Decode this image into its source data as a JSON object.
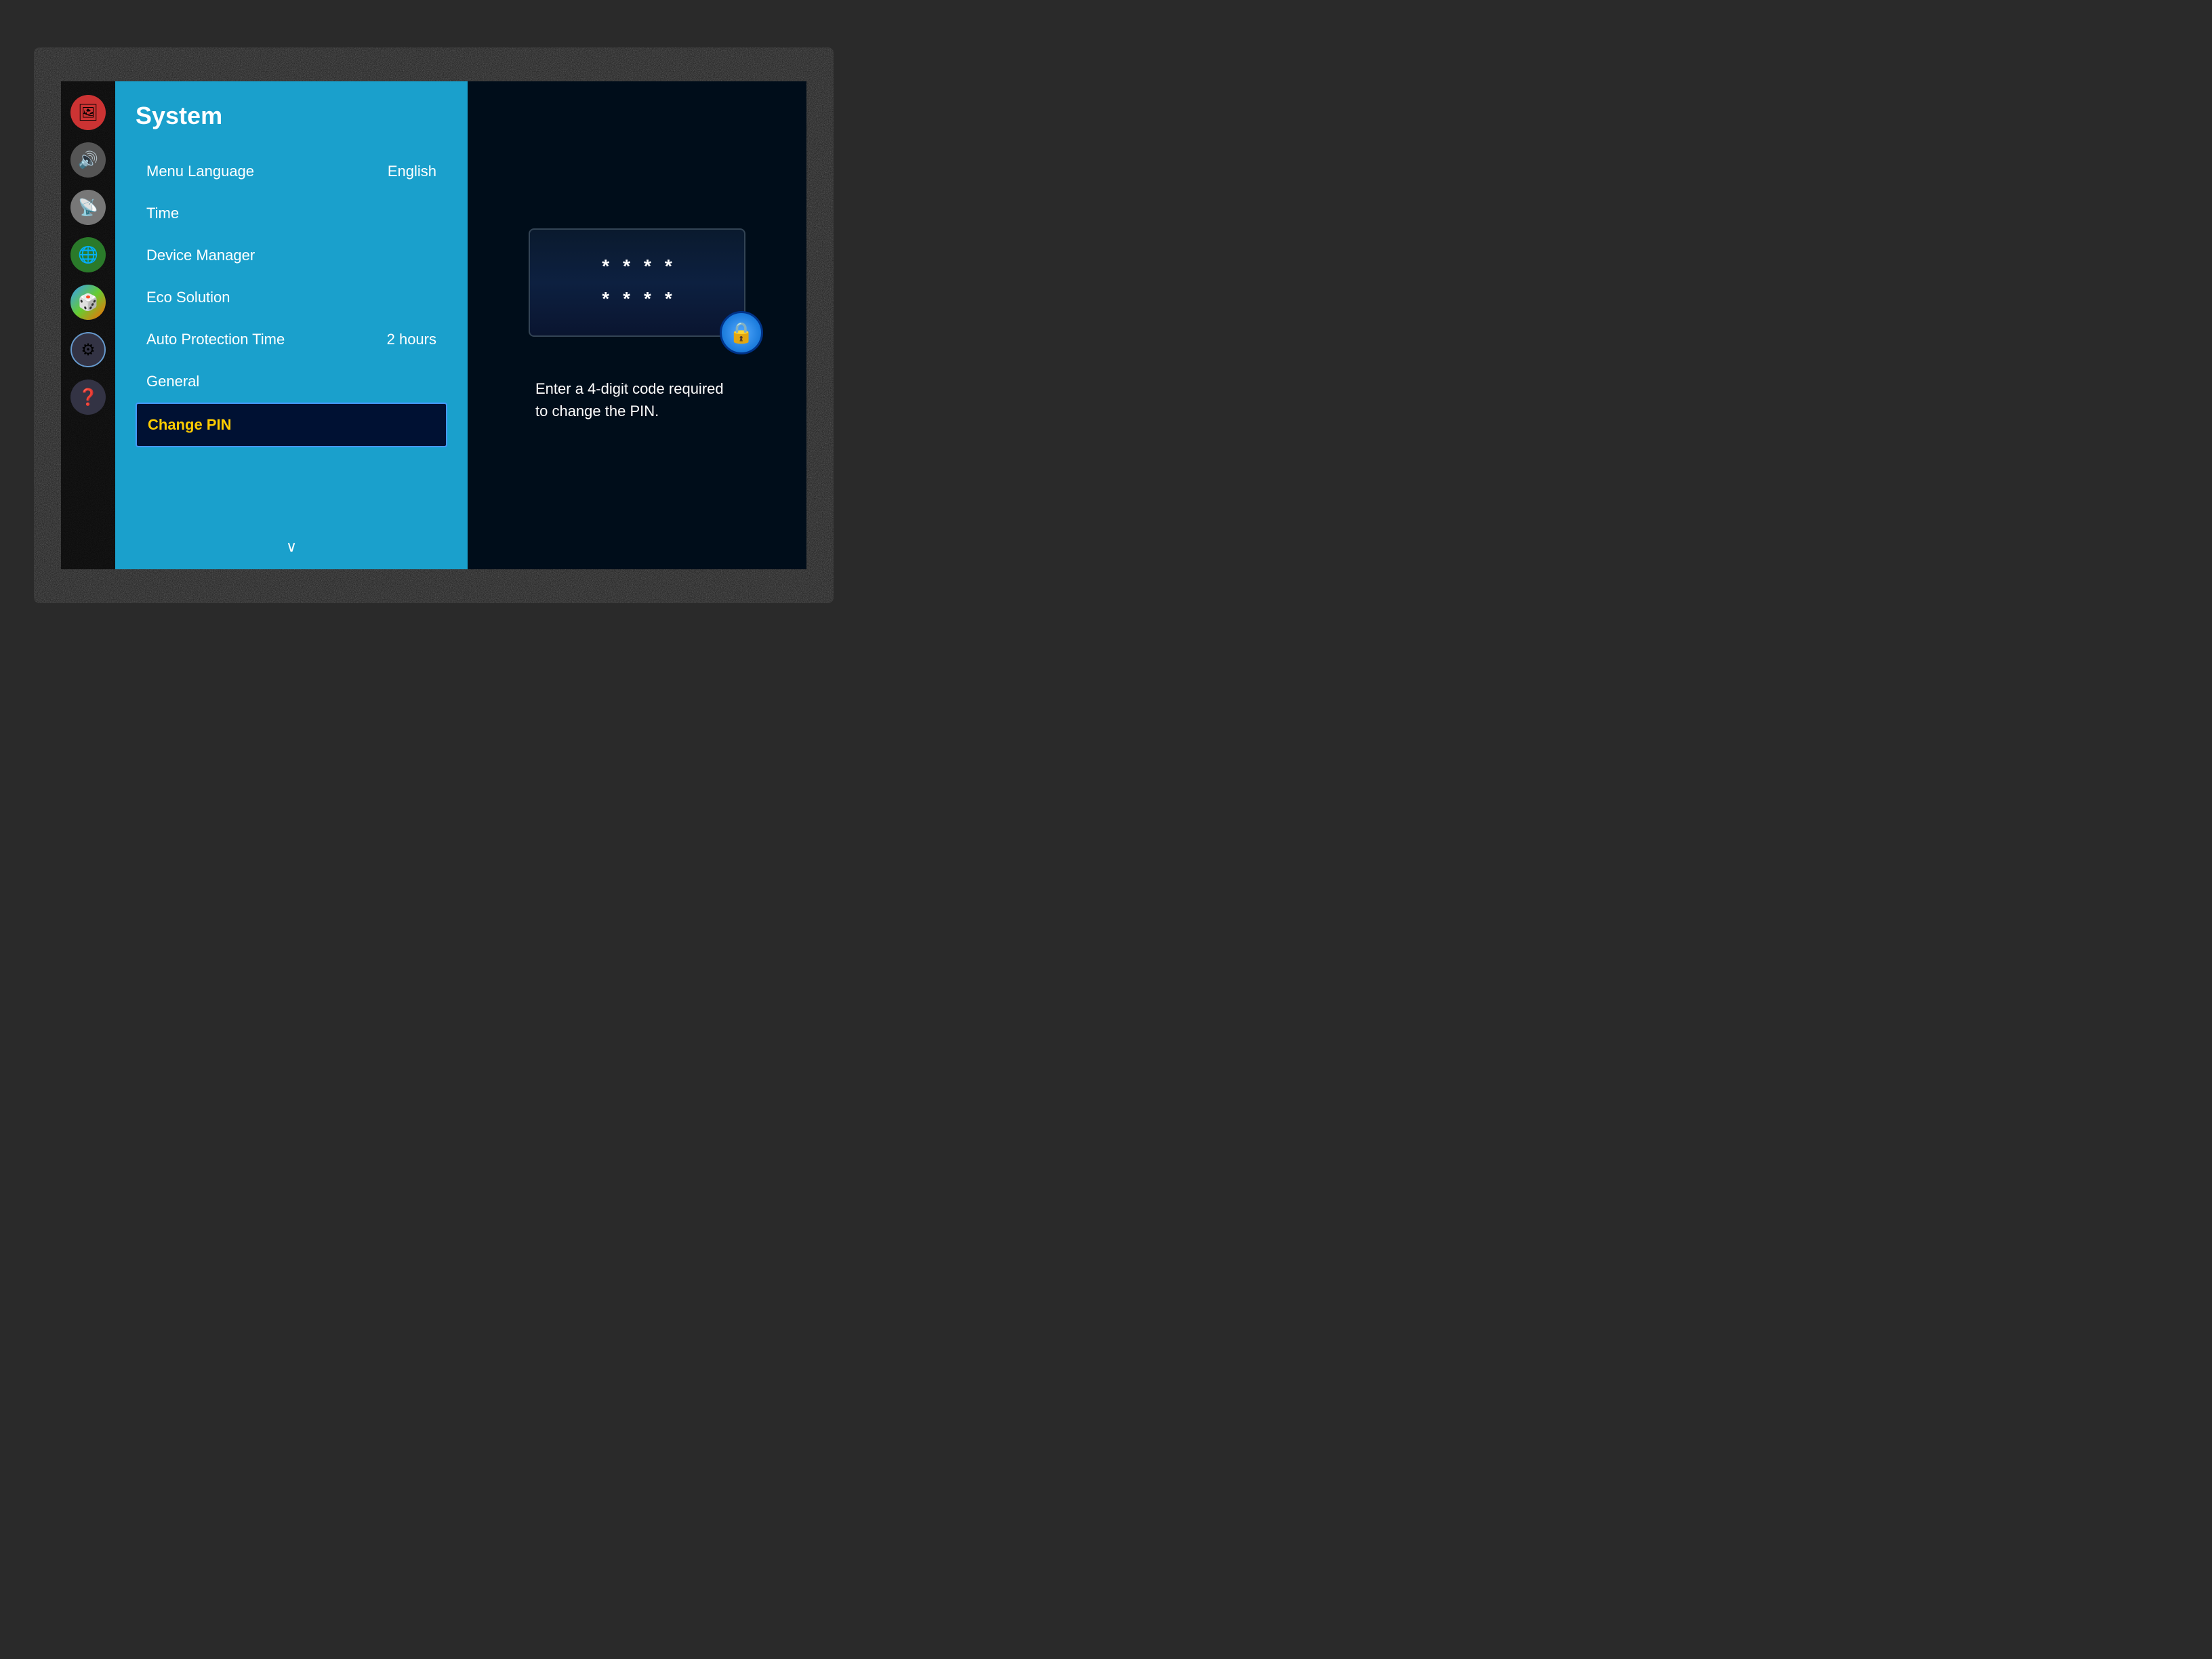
{
  "sidebar": {
    "icons": [
      {
        "name": "picture-icon",
        "label": "Picture",
        "class": "picture",
        "symbol": "🖼"
      },
      {
        "name": "sound-icon",
        "label": "Sound",
        "class": "sound",
        "symbol": "🔊"
      },
      {
        "name": "broadcast-icon",
        "label": "Broadcast",
        "class": "broadcast",
        "symbol": "📡"
      },
      {
        "name": "network-icon",
        "label": "Network",
        "class": "network",
        "symbol": "🌐"
      },
      {
        "name": "smart-hub-icon",
        "label": "Smart Hub",
        "class": "smart",
        "symbol": "🎲"
      },
      {
        "name": "system-icon",
        "label": "System",
        "class": "system",
        "symbol": "⚙"
      },
      {
        "name": "support-icon",
        "label": "Support",
        "class": "support",
        "symbol": "❓"
      }
    ]
  },
  "menu": {
    "title": "System",
    "items": [
      {
        "label": "Menu Language",
        "value": "English",
        "selected": false
      },
      {
        "label": "Time",
        "value": "",
        "selected": false
      },
      {
        "label": "Device Manager",
        "value": "",
        "selected": false
      },
      {
        "label": "Eco Solution",
        "value": "",
        "selected": false
      },
      {
        "label": "Auto Protection Time",
        "value": "2 hours",
        "selected": false
      },
      {
        "label": "General",
        "value": "",
        "selected": false
      },
      {
        "label": "Change PIN",
        "value": "",
        "selected": true
      }
    ],
    "scroll_arrow": "∨"
  },
  "pin_panel": {
    "row1_dots": "* * * *",
    "row2_dots": "* * * *",
    "lock_symbol": "🔒",
    "description": "Enter a 4-digit code required to change the PIN."
  }
}
